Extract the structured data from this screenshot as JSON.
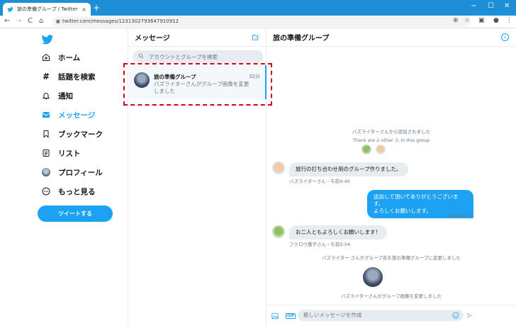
{
  "browser": {
    "tab_title": "旅の準備グループ / Twitter",
    "url": "twitter.com/messages/1231302793647910912",
    "new_tab": "+",
    "tab_close": "×",
    "back": "←",
    "forward": "→",
    "reload": "C",
    "home": "⌂",
    "win_min": "−",
    "win_max": "☐",
    "win_close": "✕"
  },
  "nav": {
    "items": [
      {
        "icon": "home-icon",
        "label": "ホーム"
      },
      {
        "icon": "hashtag-icon",
        "label": "話題を検索"
      },
      {
        "icon": "bell-icon",
        "label": "通知"
      },
      {
        "icon": "envelope-icon",
        "label": "メッセージ"
      },
      {
        "icon": "bookmark-icon",
        "label": "ブックマーク"
      },
      {
        "icon": "list-icon",
        "label": "リスト"
      },
      {
        "icon": "profile-avatar",
        "label": "プロフィール"
      },
      {
        "icon": "more-icon",
        "label": "もっと見る"
      }
    ],
    "tweet_button": "ツイートする"
  },
  "messages": {
    "title": "メッセージ",
    "search_placeholder": "アカウントとグループを検索",
    "conversation": {
      "name": "旅の準備グループ",
      "time": "32分",
      "preview": "バズライターさんがグループ画像を変更しました"
    }
  },
  "chat": {
    "title": "旅の準備グループ",
    "system_added": "バズライターさんから追加されました",
    "system_members": "There are 2 other 人 in this group",
    "msg1": {
      "text": "旅行の打ち合わせ用のグループ作りました。",
      "meta": "バズライターさん・午前4:40"
    },
    "msg2": {
      "line1": "追加して頂いてありがとうございます。",
      "line2": "よろしくお願いします。",
      "meta": "午前4:58 ✓"
    },
    "msg3": {
      "text": "お二人ともよろしくお願いします！",
      "meta": "フクロウ愚子さん・午前5:04"
    },
    "system_renamed": "バズライター さんがグループ名を旅の準備グループに変更しました",
    "system_image": "バズライターさんがグループ画像を変更しました",
    "composer_placeholder": "新しいメッセージを作成",
    "gif": "GIF"
  },
  "colors": {
    "accent": "#1da1f2",
    "highlight": "#d0021b",
    "chrome": "#1e8fd6"
  }
}
